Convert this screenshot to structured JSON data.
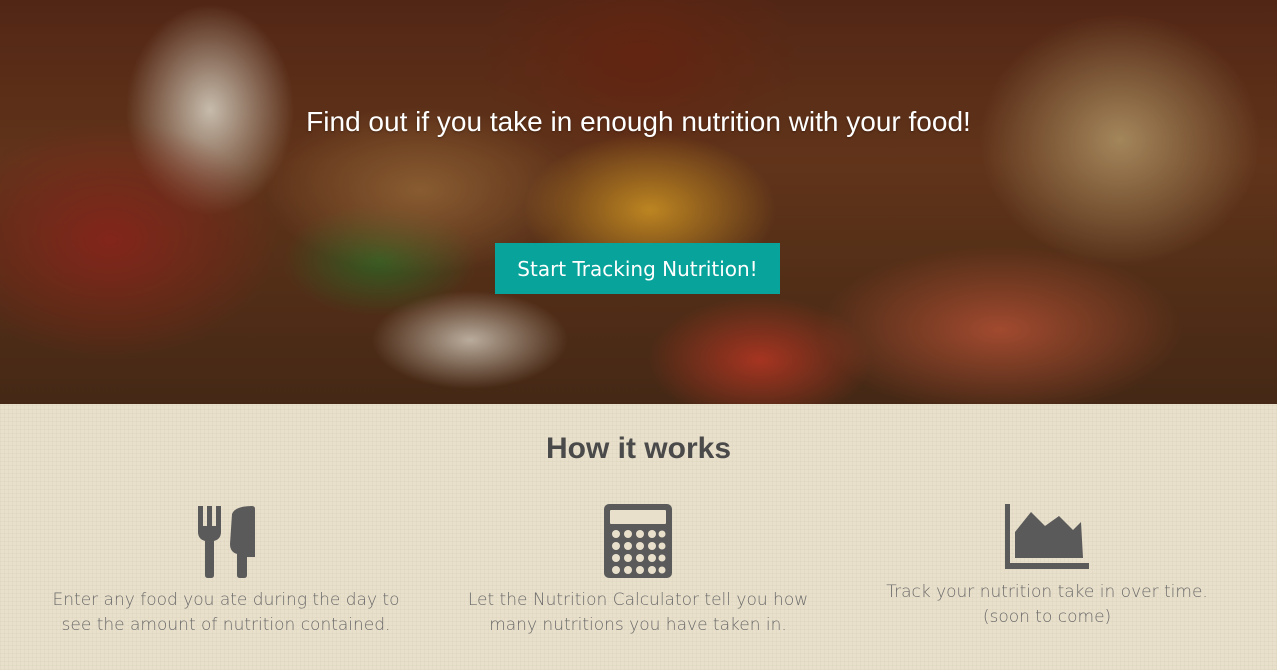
{
  "hero": {
    "title": "Find out if you take in enough nutrition with your food!",
    "cta_label": "Start Tracking Nutrition!"
  },
  "how": {
    "title": "How it works",
    "features": [
      {
        "icon": "fork-knife-icon",
        "line1": "Enter any food you ate during the day to",
        "line2": "see the amount of nutrition contained."
      },
      {
        "icon": "calculator-icon",
        "line1": "Let the Nutrition Calculator tell you how",
        "line2": "many nutritions you have taken in."
      },
      {
        "icon": "area-chart-icon",
        "line1": "Track your nutrition take in over time.",
        "line2": "(soon to come)"
      }
    ]
  },
  "colors": {
    "accent": "#08a39a",
    "icon": "#5a5a5a",
    "background": "#e9e0cb"
  }
}
